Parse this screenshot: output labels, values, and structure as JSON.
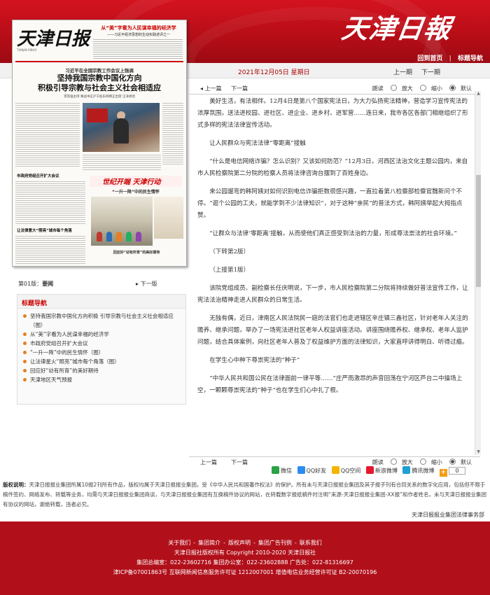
{
  "header": {
    "logo": "天津日報",
    "links": [
      "回到首页",
      "标题导航"
    ],
    "separator": "|"
  },
  "datebar": {
    "date": "2021年12月05日 星期日",
    "prev": "上一期",
    "next": "下一期"
  },
  "newspaper": {
    "masthead": "天津日报",
    "masthead_sub": "TIANJIN RIBAO",
    "top_headline": "从“美”字看为人民谋幸福的经济学",
    "top_subhead": "——习近平经济思想的生动实践述评之一",
    "kicker": "习近平在全国宗教工作会议上强调",
    "headline_line1": "坚持我国宗教中国化方向",
    "headline_line2": "积极引导宗教与社会主义社会相适应",
    "byline": "李克强主持 栗战书王沪宁赵乐际韩正出席 汪洋讲话",
    "left_head1": "市政府党组召开扩大会议",
    "left_head2": "让法律意大“照亮”城市每个角落",
    "stamp": "世纪开端 天津行动",
    "feature_head": "“一升一降”中的民生情怀",
    "foot_head": "回应好“幼有所育”的美好期待"
  },
  "page_nav": {
    "page_label": "第01版：",
    "page_name": "要闻",
    "next_page": "下一版",
    "arrow": "▸"
  },
  "title_nav": {
    "heading": "标题导航",
    "items": [
      "坚持我国宗教中国化方向积极 引导宗教与社会主义社会相适应（图）",
      "从“美”字看为人民谋幸福的经济学",
      "市政府党组召开扩大会议",
      "“一升一降”中的民生情怀（图）",
      "让法律星火“照亮”城市每个角落（图）",
      "回应好“幼有所育”的美好期待",
      "天津地区天气预报"
    ]
  },
  "toolbar": {
    "prev": "上一篇",
    "next": "下一篇",
    "arrow": "◂",
    "read": "朗读",
    "zoom_in": "放大",
    "zoom_out": "缩小",
    "default": "默认"
  },
  "article": {
    "paragraphs": [
      "美好生活，有法相伴。12月4日是第八个国家宪法日，为大力弘扬宪法精神，营造学习宣传宪法的浓厚氛围，送法进校园、进社区、进企业、进乡村、进军营……连日来，我市各区各部门相继组织了形式多样的宪法法律宣传活动。",
      "让人民群众与宪法法律“零距离”接触",
      "“什么是电信网络诈骗？怎么识别？又该如何防范？”12月3日，河西区法治文化主题公园内，来自市人民检察院第二分院的检察人员将法律咨询台摆到了百姓身边。",
      "来公园遛弯的韩阿姨对如何识别电信诈骗拒数很感兴趣，一直拉着第八检察部检察官魏新问个不停。“逛个公园的工夫，就能学到不少法律知识”，对于这种“亲民”的普法方式，韩阿姨举起大拇指点赞。",
      "“让群众与法律‘零距离’接触，从而使他们真正感受到法治的力量，形成尊法崇法的社会环境。”",
      "（下转第2版）",
      "（上接第1版）",
      "该院党组成员、副检察长任庆明说，下一步，市人民检察院第二分院将持续做好普法宣传工作，让宪法法治精神走进人民群众的日常生活。",
      "无独有偶，近日，津南区人民法院民一庭的法官们也走进辖区辛庄镇三鑫社区，针对老年人关注的赡养、继承问题，举办了一场宪法进社区老年人权益讲座活动。讲座围绕赡养权、继承权、老年人监护问题，结合具体案例，向社区老年人普及了权益维护方面的法律知识，大家直呼讲得明白、听得过瘾。",
      "在学生心中种下尊崇宪法的“种子”",
      "“中华人民共和国公民在法律面前一律平等……”庄严而激昂的声音回荡在宁河区芦台二中操场上空，一颗颗尊崇宪法的“种子”也在学生们心中扎了根。"
    ]
  },
  "share": {
    "items": [
      {
        "label": "微信",
        "color": "#2ba245",
        "icon": "wechat-icon"
      },
      {
        "label": "QQ好友",
        "color": "#2d8cf0",
        "icon": "qq-icon"
      },
      {
        "label": "QQ空间",
        "color": "#f5b400",
        "icon": "qzone-icon"
      },
      {
        "label": "新浪微博",
        "color": "#e6162d",
        "icon": "weibo-icon"
      },
      {
        "label": "腾讯微博",
        "color": "#1e9ed6",
        "icon": "tencent-weibo-icon"
      }
    ],
    "count": "0",
    "plus": "+"
  },
  "copyright": {
    "label": "版权说明：",
    "text": "天津日报报业集团所属10报2刊所有作品，版权均属于天津日报报业集团。受《中华人民共和国著作权法》的保护。所有未与天津日报报业集团及其子报子刊有合同关系的数字化应用，包括但不限于稿件签约、网络发布、转载等业务，均需与天津日报报业集团商谈，与天津日报报业集团有互换稿件协议的网站，在转载数字报纸稿件时注明“来源-天津日报报业集团-XX报”和作者姓名，未与天津日报报业集团有协议的网站，谢绝转载，违者必究。",
    "legal": "天津日报报业集团法律事务部"
  },
  "footer": {
    "links": [
      "关于我们",
      "集团简介",
      "版权声明",
      "集团广告刊例",
      "联系我们"
    ],
    "link_sep": "-",
    "line2": "天津日报社版权所有 Copyright 2010-2020 天津日报社",
    "line3": "集团总编室：022-23602716 集团办公室：022-23602888 广告处：022-81316697",
    "line4": "津ICP备07001863号 互联网新闻信息服务许可证 1212007001 增值电信业务经营许可证 B2-20070196"
  },
  "colors": {
    "brand_red": "#b1101b",
    "accent_red": "#cc0000",
    "bullet_orange": "#e67e22"
  }
}
